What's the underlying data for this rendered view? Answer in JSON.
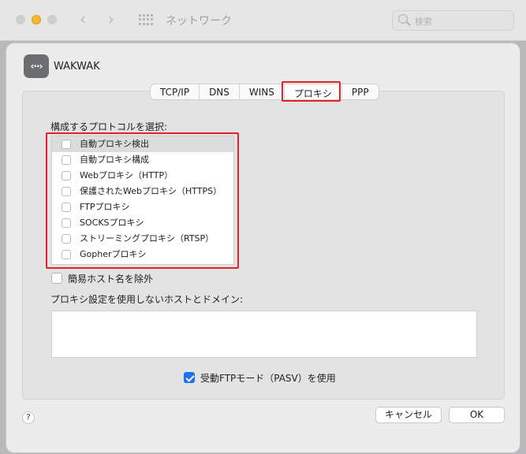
{
  "window": {
    "title": "ネットワーク",
    "search_placeholder": "検索"
  },
  "interface": {
    "name": "WAKWAK",
    "icon": "network-dots-icon"
  },
  "tabs": [
    {
      "label": "TCP/IP",
      "selected": false
    },
    {
      "label": "DNS",
      "selected": false
    },
    {
      "label": "WINS",
      "selected": false
    },
    {
      "label": "プロキシ",
      "selected": true
    },
    {
      "label": "PPP",
      "selected": false
    }
  ],
  "proxy": {
    "section_label": "構成するプロトコルを選択:",
    "protocols": [
      {
        "label": "自動プロキシ検出",
        "checked": false,
        "selected": true
      },
      {
        "label": "自動プロキシ構成",
        "checked": false,
        "selected": false
      },
      {
        "label": "Webプロキシ（HTTP）",
        "checked": false,
        "selected": false
      },
      {
        "label": "保護されたWebプロキシ（HTTPS）",
        "checked": false,
        "selected": false
      },
      {
        "label": "FTPプロキシ",
        "checked": false,
        "selected": false
      },
      {
        "label": "SOCKSプロキシ",
        "checked": false,
        "selected": false
      },
      {
        "label": "ストリーミングプロキシ（RTSP）",
        "checked": false,
        "selected": false
      },
      {
        "label": "Gopherプロキシ",
        "checked": false,
        "selected": false
      }
    ],
    "exclude_simple_hostnames": {
      "label": "簡易ホスト名を除外",
      "checked": false
    },
    "bypass_label": "プロキシ設定を使用しないホストとドメイン:",
    "bypass_value": "",
    "passive_ftp": {
      "label": "受動FTPモード（PASV）を使用",
      "checked": true
    }
  },
  "buttons": {
    "help": "?",
    "cancel": "キャンセル",
    "ok": "OK"
  },
  "colors": {
    "highlight": "#e2212b",
    "accent": "#1e6ff2"
  }
}
